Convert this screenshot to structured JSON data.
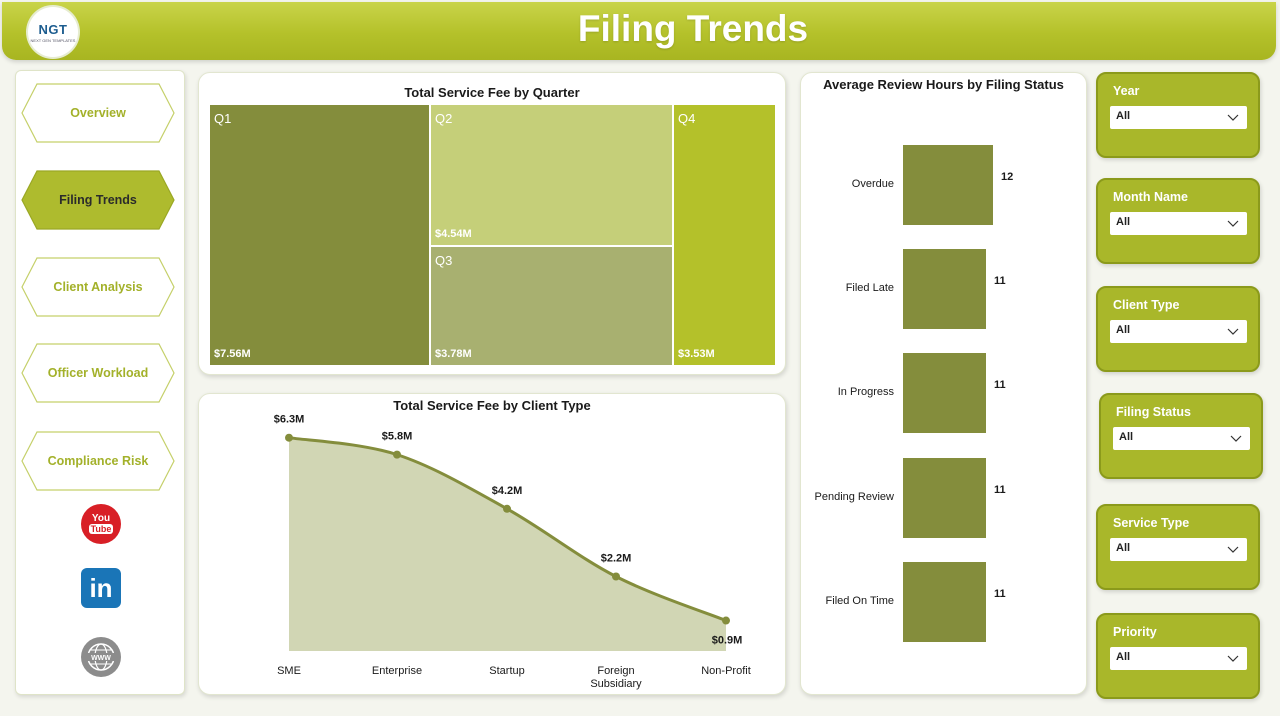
{
  "header": {
    "title": "Filing Trends",
    "logo_text": "NGT",
    "logo_subtext": "NEXT GEN TEMPLATES"
  },
  "nav": {
    "items": [
      {
        "label": "Overview",
        "active": false
      },
      {
        "label": "Filing Trends",
        "active": true
      },
      {
        "label": "Client Analysis",
        "active": false
      },
      {
        "label": "Officer Workload",
        "active": false
      },
      {
        "label": "Compliance Risk",
        "active": false
      }
    ],
    "social": {
      "youtube_top": "You",
      "youtube_bottom": "Tube",
      "linkedin": "in"
    }
  },
  "charts": {
    "treemap_title": "Total Service Fee by Quarter",
    "area_title": "Total Service Fee by Client Type",
    "bar_title": "Average Review Hours by Filing Status"
  },
  "chart_data": [
    {
      "type": "treemap",
      "title": "Total Service Fee by Quarter",
      "categories": [
        "Q1",
        "Q2",
        "Q3",
        "Q4"
      ],
      "values": [
        7.56,
        4.54,
        3.78,
        3.53
      ],
      "value_labels": [
        "$7.56M",
        "$4.54M",
        "$3.78M",
        "$3.53M"
      ],
      "colors": [
        "#848d3c",
        "#c5cf79",
        "#a8b070",
        "#b4c12a"
      ]
    },
    {
      "type": "area",
      "title": "Total Service Fee by Client Type",
      "categories": [
        "SME",
        "Enterprise",
        "Startup",
        "Foreign Subsidiary",
        "Non-Profit"
      ],
      "values": [
        6.3,
        5.8,
        4.2,
        2.2,
        0.9
      ],
      "value_labels": [
        "$6.3M",
        "$5.8M",
        "$4.2M",
        "$2.2M",
        "$0.9M"
      ],
      "ylim": [
        0,
        7
      ],
      "colors": {
        "line": "#848d3c",
        "fill": "#d1d6b4"
      }
    },
    {
      "type": "bar",
      "orientation": "horizontal",
      "title": "Average Review Hours by Filing Status",
      "categories": [
        "Overdue",
        "Filed Late",
        "In Progress",
        "Pending Review",
        "Filed On Time"
      ],
      "values": [
        12,
        11,
        11,
        11,
        11
      ],
      "colors": {
        "bar": "#848d3c"
      }
    }
  ],
  "slicers": [
    {
      "title": "Year",
      "value": "All"
    },
    {
      "title": "Month Name",
      "value": "All"
    },
    {
      "title": "Client Type",
      "value": "All"
    },
    {
      "title": "Filing Status",
      "value": "All"
    },
    {
      "title": "Service Type",
      "value": "All"
    },
    {
      "title": "Priority",
      "value": "All"
    }
  ],
  "colors": {
    "accent": "#b4c12a",
    "dark_olive": "#848d3c"
  }
}
